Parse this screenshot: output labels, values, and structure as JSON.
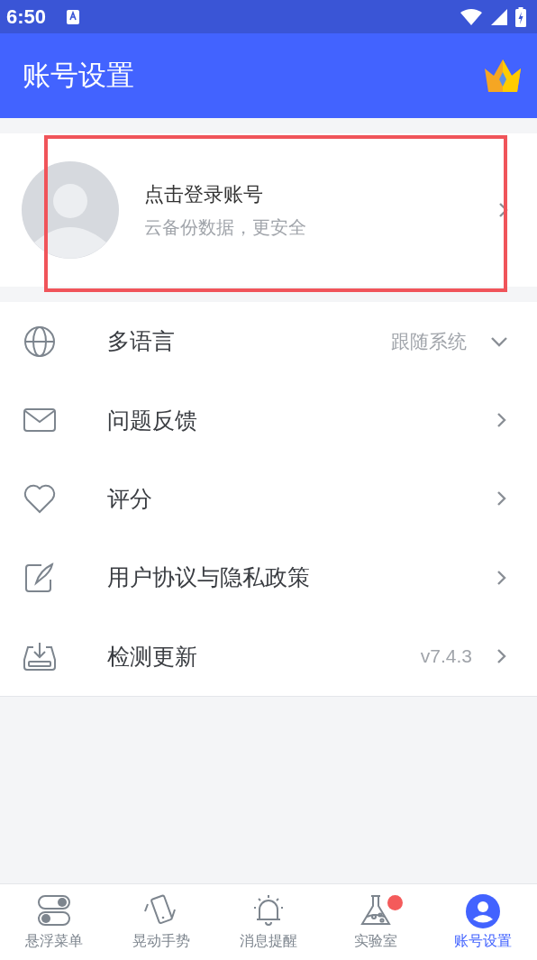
{
  "status_bar": {
    "time": "6:50"
  },
  "app_bar": {
    "title": "账号设置"
  },
  "login_card": {
    "title": "点击登录账号",
    "subtitle": "云备份数据，更安全",
    "highlighted": true
  },
  "settings": [
    {
      "label": "多语言",
      "value": "跟随系统",
      "kind": "dropdown"
    },
    {
      "label": "问题反馈",
      "kind": "link"
    },
    {
      "label": "评分",
      "kind": "link"
    },
    {
      "label": "用户协议与隐私政策",
      "kind": "link"
    },
    {
      "label": "检测更新",
      "value": "v7.4.3",
      "kind": "link"
    }
  ],
  "tabs": [
    {
      "label": "悬浮菜单",
      "selected": false,
      "dot": false
    },
    {
      "label": "晃动手势",
      "selected": false,
      "dot": false
    },
    {
      "label": "消息提醒",
      "selected": false,
      "dot": false
    },
    {
      "label": "实验室",
      "selected": false,
      "dot": true
    },
    {
      "label": "账号设置",
      "selected": true,
      "dot": false
    }
  ]
}
